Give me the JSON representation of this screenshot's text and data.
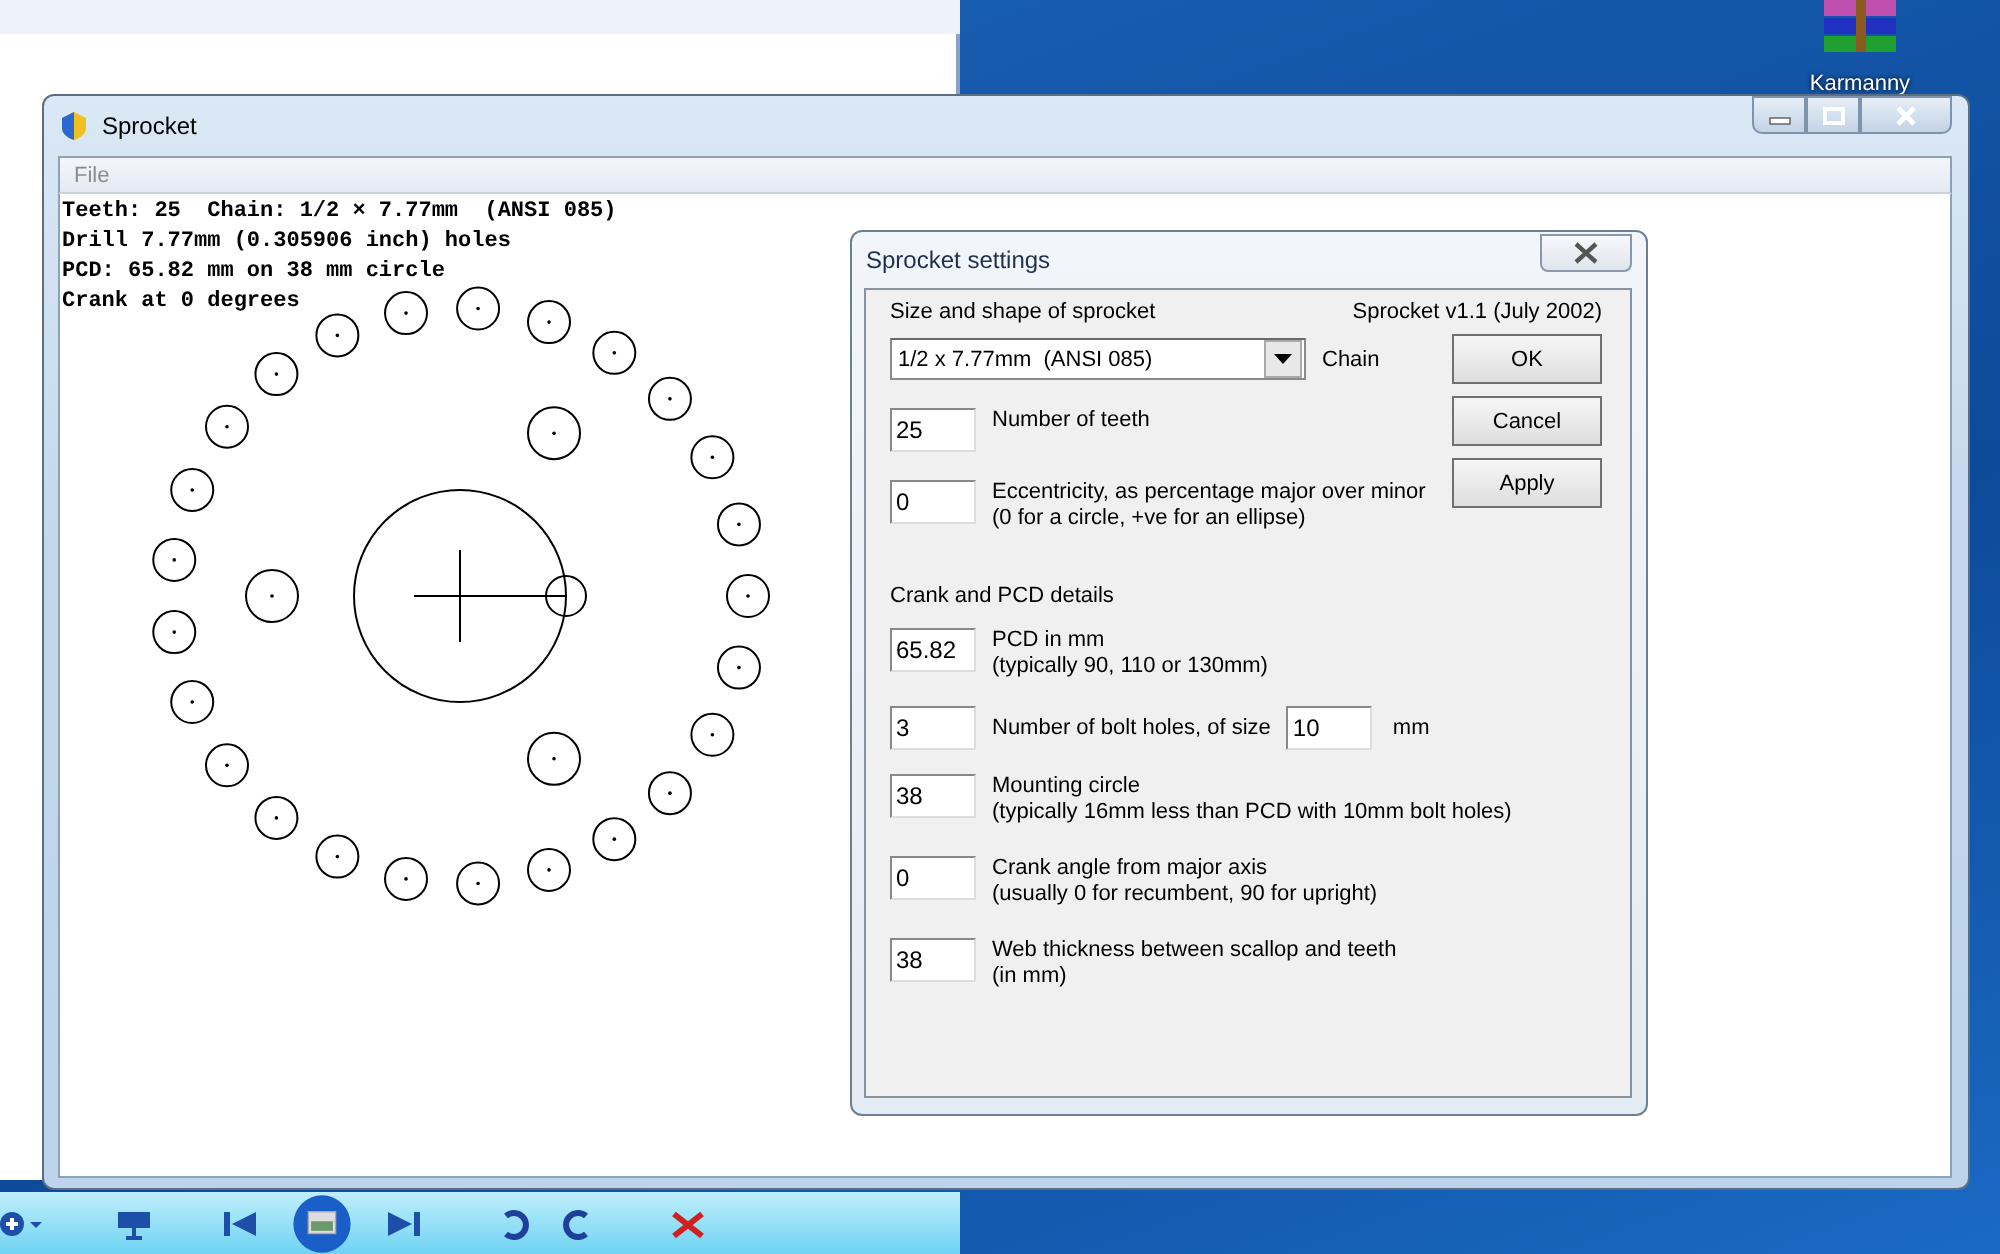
{
  "desktop_icons": [
    {
      "label": "Karmanny"
    }
  ],
  "window": {
    "title": "Sprocket",
    "menu": [
      "File"
    ],
    "info_lines": [
      "Teeth: 25  Chain: 1/2 × 7.77mm  (ANSI 085)",
      "Drill 7.77mm (0.305906 inch) holes",
      "PCD: 65.82 mm on 38 mm circle",
      "Crank at 0 degrees"
    ]
  },
  "dialog": {
    "title": "Sprocket settings",
    "heading": "Size and shape of sprocket",
    "version": "Sprocket v1.1 (July 2002)",
    "chain": {
      "value": "1/2 x 7.77mm  (ANSI 085)",
      "label": "Chain"
    },
    "fields": [
      {
        "value": "25",
        "label": "Number of teeth"
      },
      {
        "value": "0",
        "label": "Eccentricity, as percentage major over minor",
        "hint": "(0 for a circle, +ve for an ellipse)"
      }
    ],
    "section": "Crank and PCD details",
    "crank_fields": [
      {
        "value": "65.82",
        "label": "PCD in mm",
        "hint": "(typically 90, 110 or 130mm)"
      },
      {
        "value": "3",
        "label": "Number of bolt holes, of size",
        "size_value": "10",
        "unit": "mm"
      },
      {
        "value": "38",
        "label": "Mounting circle",
        "hint": "(typically 16mm less than PCD with 10mm bolt holes)"
      },
      {
        "value": "0",
        "label": "Crank angle from major axis",
        "hint": "(usually 0 for recumbent, 90 for upright)"
      },
      {
        "value": "38",
        "label": "Web thickness between scallop and teeth",
        "hint": "(in mm)"
      }
    ],
    "buttons": [
      "OK",
      "Cancel",
      "Apply"
    ]
  }
}
